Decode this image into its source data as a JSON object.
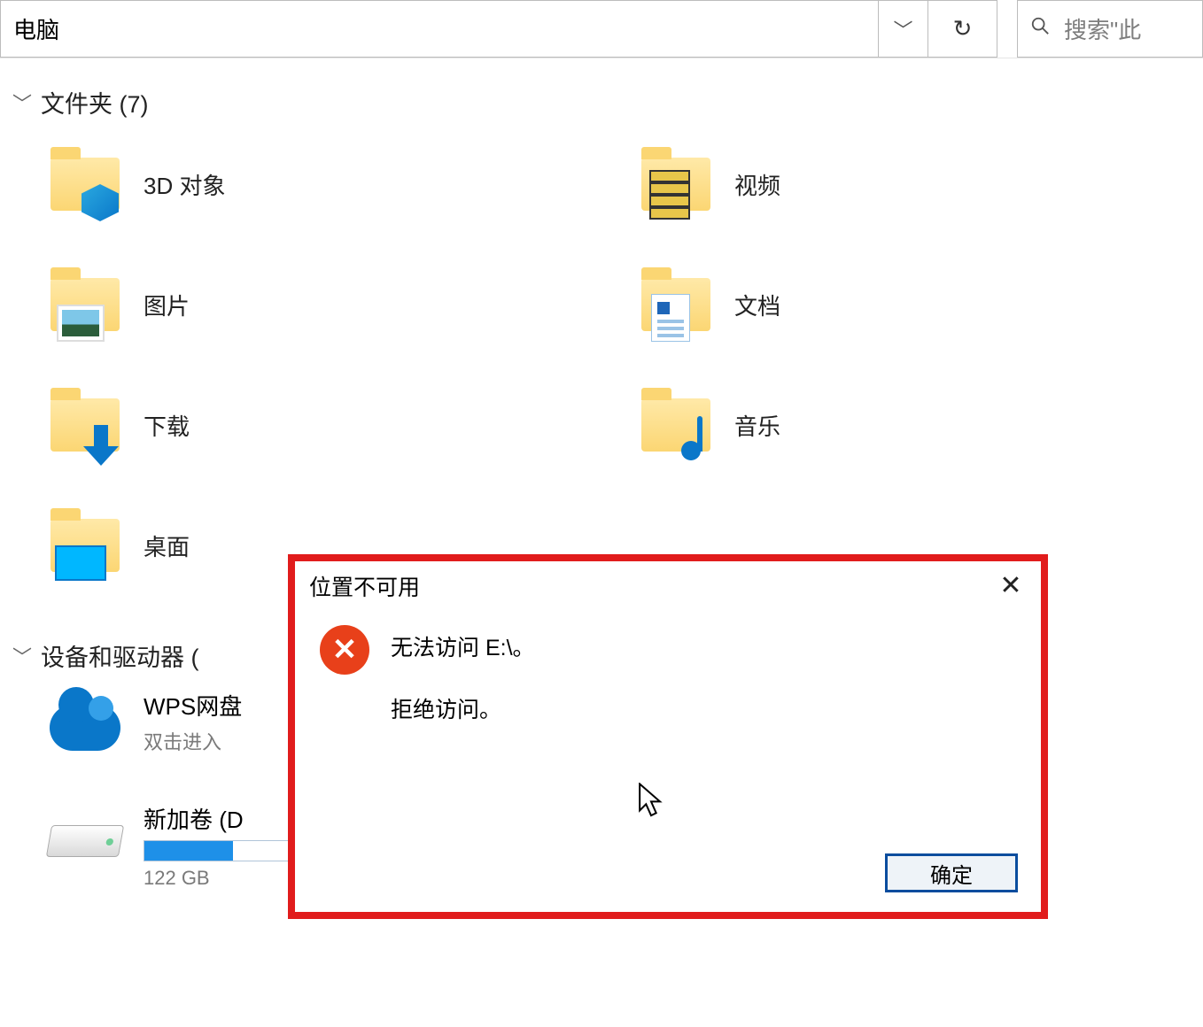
{
  "addressbar": {
    "path_text": "电脑",
    "search_placeholder": "搜索\"此"
  },
  "groups": {
    "folders_header": "文件夹 (7)",
    "devices_header": "设备和驱动器 ("
  },
  "folders": {
    "objects3d": "3D 对象",
    "videos": "视频",
    "pictures": "图片",
    "documents": "文档",
    "downloads": "下载",
    "music": "音乐",
    "desktop": "桌面"
  },
  "devices": {
    "wps": {
      "title": "WPS网盘",
      "subtitle": "双击进入"
    },
    "volume": {
      "title": "新加卷 (D",
      "capacity_text": "122 GB",
      "usage_percent": 28
    }
  },
  "dialog": {
    "title": "位置不可用",
    "message_line1": "无法访问 E:\\。",
    "message_line2": "拒绝访问。",
    "ok_label": "确定"
  }
}
